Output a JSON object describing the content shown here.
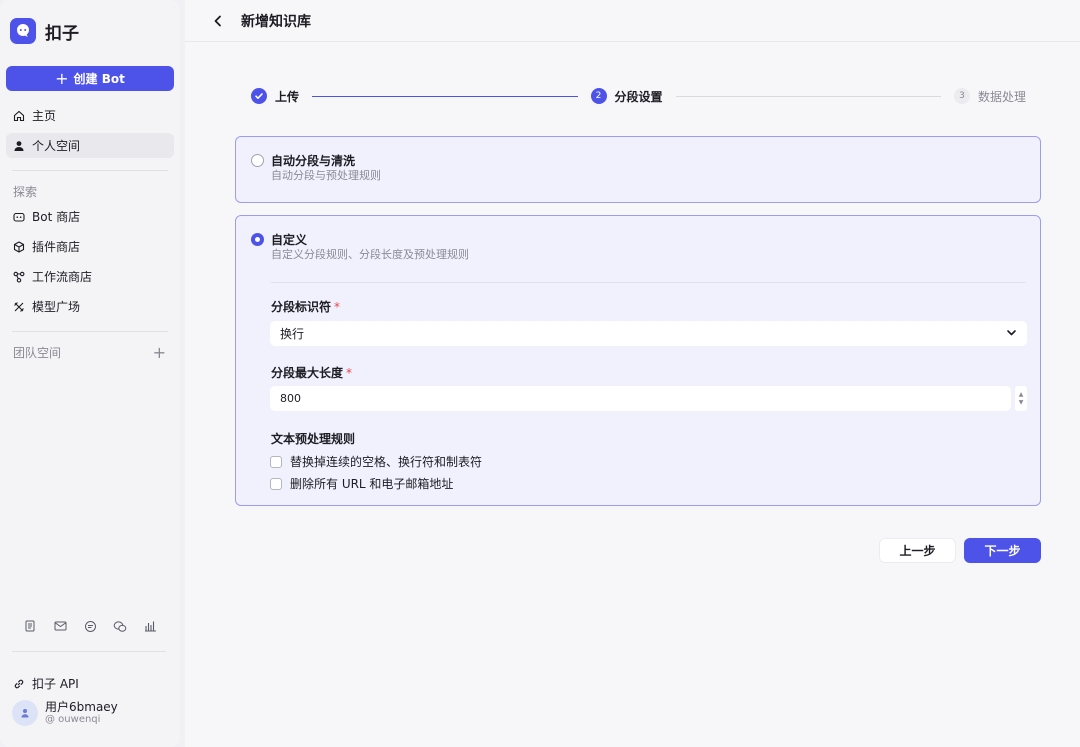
{
  "sidebar": {
    "brand": "扣子",
    "create_button": "创建 Bot",
    "nav": [
      {
        "label": "主页",
        "icon": "home-icon"
      },
      {
        "label": "个人空间",
        "icon": "user-icon",
        "active": true
      }
    ],
    "explore_label": "探索",
    "explore_items": [
      {
        "label": "Bot 商店",
        "icon": "bot-icon"
      },
      {
        "label": "插件商店",
        "icon": "cube-icon"
      },
      {
        "label": "工作流商店",
        "icon": "workflow-icon"
      },
      {
        "label": "模型广场",
        "icon": "model-icon"
      }
    ],
    "team_label": "团队空间",
    "footer_icons": [
      "document-icon",
      "mail-icon",
      "chat-icon",
      "wechat-icon",
      "chart-icon"
    ],
    "api_label": "扣子 API",
    "user": {
      "name": "用户6bmaey",
      "handle": "@ ouwenqi"
    }
  },
  "header": {
    "title": "新增知识库"
  },
  "steps": [
    {
      "number": "1",
      "label": "上传",
      "state": "done"
    },
    {
      "number": "2",
      "label": "分段设置",
      "state": "current"
    },
    {
      "number": "3",
      "label": "数据处理",
      "state": "todo"
    }
  ],
  "auto_option": {
    "title": "自动分段与清洗",
    "description": "自动分段与预处理规则",
    "selected": false
  },
  "custom_option": {
    "title": "自定义",
    "description": "自定义分段规则、分段长度及预处理规则",
    "selected": true,
    "separator_label": "分段标识符",
    "separator_value": "换行",
    "max_length_label": "分段最大长度",
    "max_length_value": "800",
    "required_mark": "*",
    "preprocess_label": "文本预处理规则",
    "rules": [
      {
        "label": "替换掉连续的空格、换行符和制表符",
        "checked": false
      },
      {
        "label": "删除所有 URL 和电子邮箱地址",
        "checked": false
      }
    ]
  },
  "footer": {
    "prev_label": "上一步",
    "next_label": "下一步"
  },
  "colors": {
    "accent": "#4d53e8",
    "card_border": "#9c9df0",
    "card_bg": "#f1f1fd"
  }
}
